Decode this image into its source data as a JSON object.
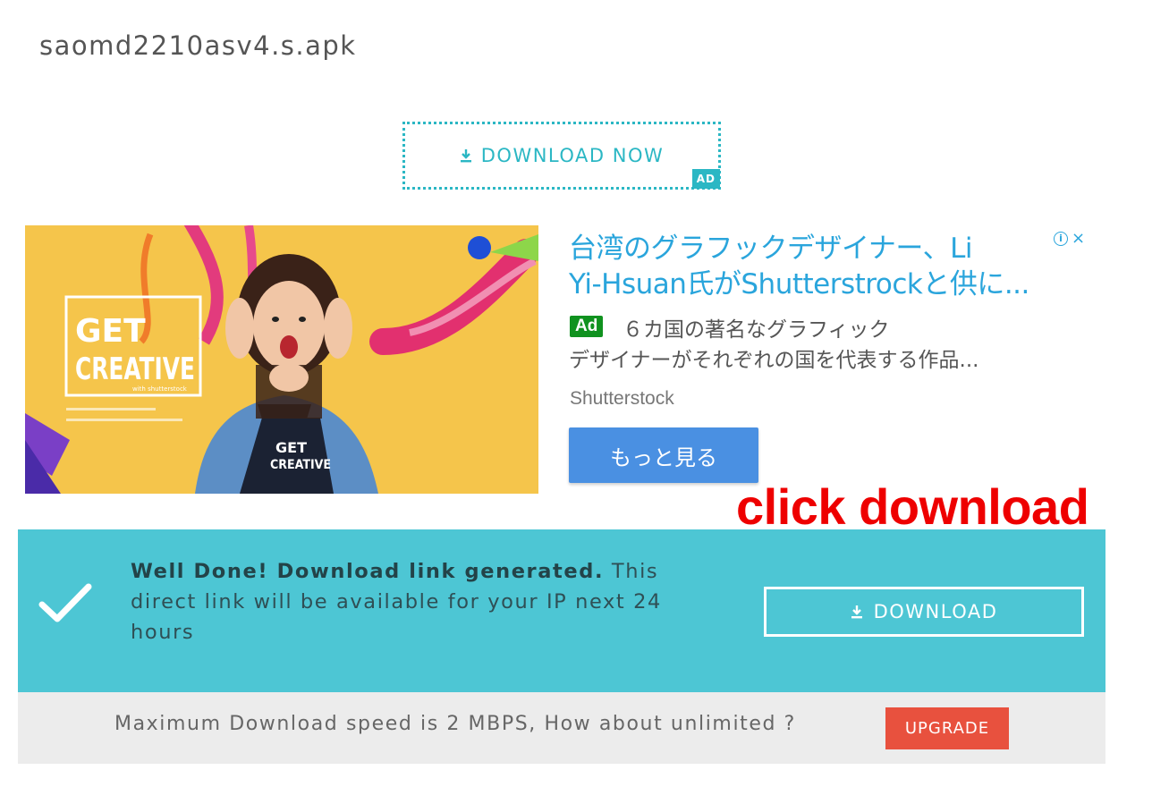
{
  "file": {
    "name": "saomd2210asv4.s.apk"
  },
  "download_now": {
    "label": "DOWNLOAD NOW",
    "icon": "download-icon",
    "ad_tag": "AD"
  },
  "ad": {
    "image_text": {
      "headline1": "GET",
      "headline2": "CREATIVE",
      "sub": "with shutterstock",
      "shirt1": "GET",
      "shirt2": "CREATIVE"
    },
    "title_line1": "台湾のグラフックデザイナー、Li",
    "title_line2": "Yi-Hsuan氏がShutterstrockと供に...",
    "badge": "Ad",
    "desc_line1": "６カ国の著名なグラフィック",
    "desc_line2": "デザイナーがそれぞれの国を代表する作品...",
    "advertiser": "Shutterstock",
    "cta": "もっと見る",
    "info_icon": "ⓘ",
    "close_icon": "×"
  },
  "annotation": {
    "text": "click download",
    "color": "#ee0000"
  },
  "success": {
    "bold": "Well Done! Download link generated.",
    "rest": " This direct link will be available for your IP next 24 hours",
    "button_label": "DOWNLOAD",
    "button_icon": "download-icon",
    "color": "#4dc6d4"
  },
  "upgrade": {
    "text": "Maximum Download speed is 2 MBPS, How about unlimited ?",
    "button": "UPGRADE",
    "color": "#e8513e"
  }
}
